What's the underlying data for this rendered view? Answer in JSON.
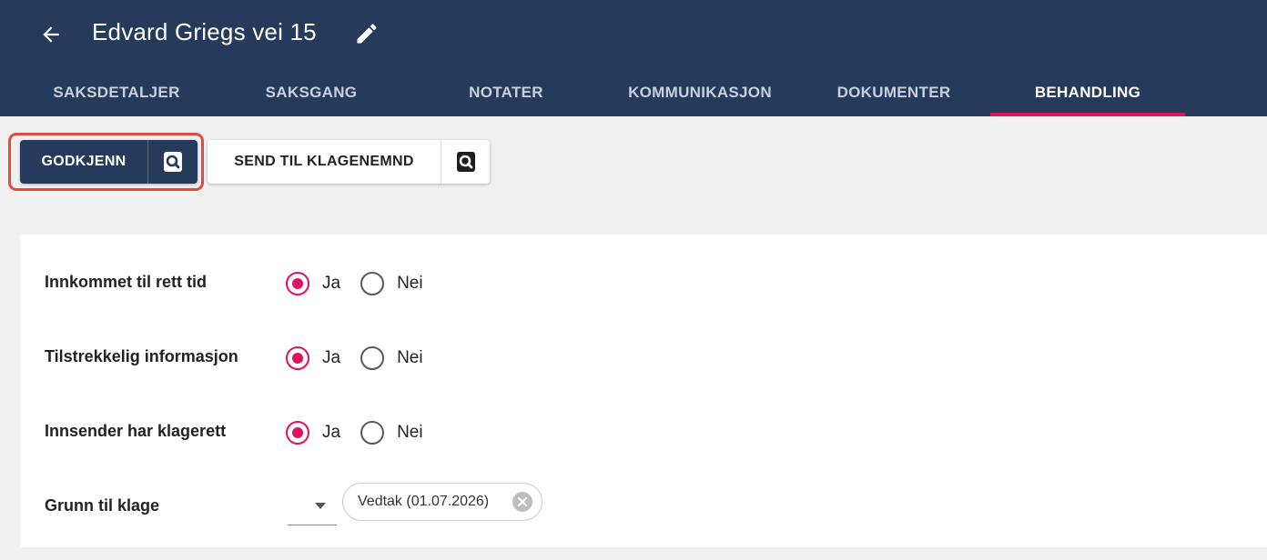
{
  "header": {
    "title": "Edvard Griegs vei 15",
    "back_icon": "arrow-left-icon",
    "edit_icon": "pencil-icon"
  },
  "tabs": [
    {
      "label": "SAKSDETALJER",
      "active": false
    },
    {
      "label": "SAKSGANG",
      "active": false
    },
    {
      "label": "NOTATER",
      "active": false
    },
    {
      "label": "KOMMUNIKASJON",
      "active": false
    },
    {
      "label": "DOKUMENTER",
      "active": false
    },
    {
      "label": "BEHANDLING",
      "active": true
    }
  ],
  "actions": {
    "approve_label": "GODKJENN",
    "send_label": "SEND TIL KLAGENEMND",
    "preview_icon": "document-search-icon"
  },
  "form": {
    "fields": [
      {
        "label": "Innkommet til rett tid",
        "options": [
          "Ja",
          "Nei"
        ],
        "selected": "Ja"
      },
      {
        "label": "Tilstrekkelig informasjon",
        "options": [
          "Ja",
          "Nei"
        ],
        "selected": "Ja"
      },
      {
        "label": "Innsender har klagerett",
        "options": [
          "Ja",
          "Nei"
        ],
        "selected": "Ja"
      }
    ],
    "reason": {
      "label": "Grunn til klage",
      "chip": "Vedtak (01.07.2026)"
    }
  },
  "colors": {
    "header_bg": "#263a5b",
    "accent": "#e0115f",
    "highlight": "#e04c3f"
  }
}
